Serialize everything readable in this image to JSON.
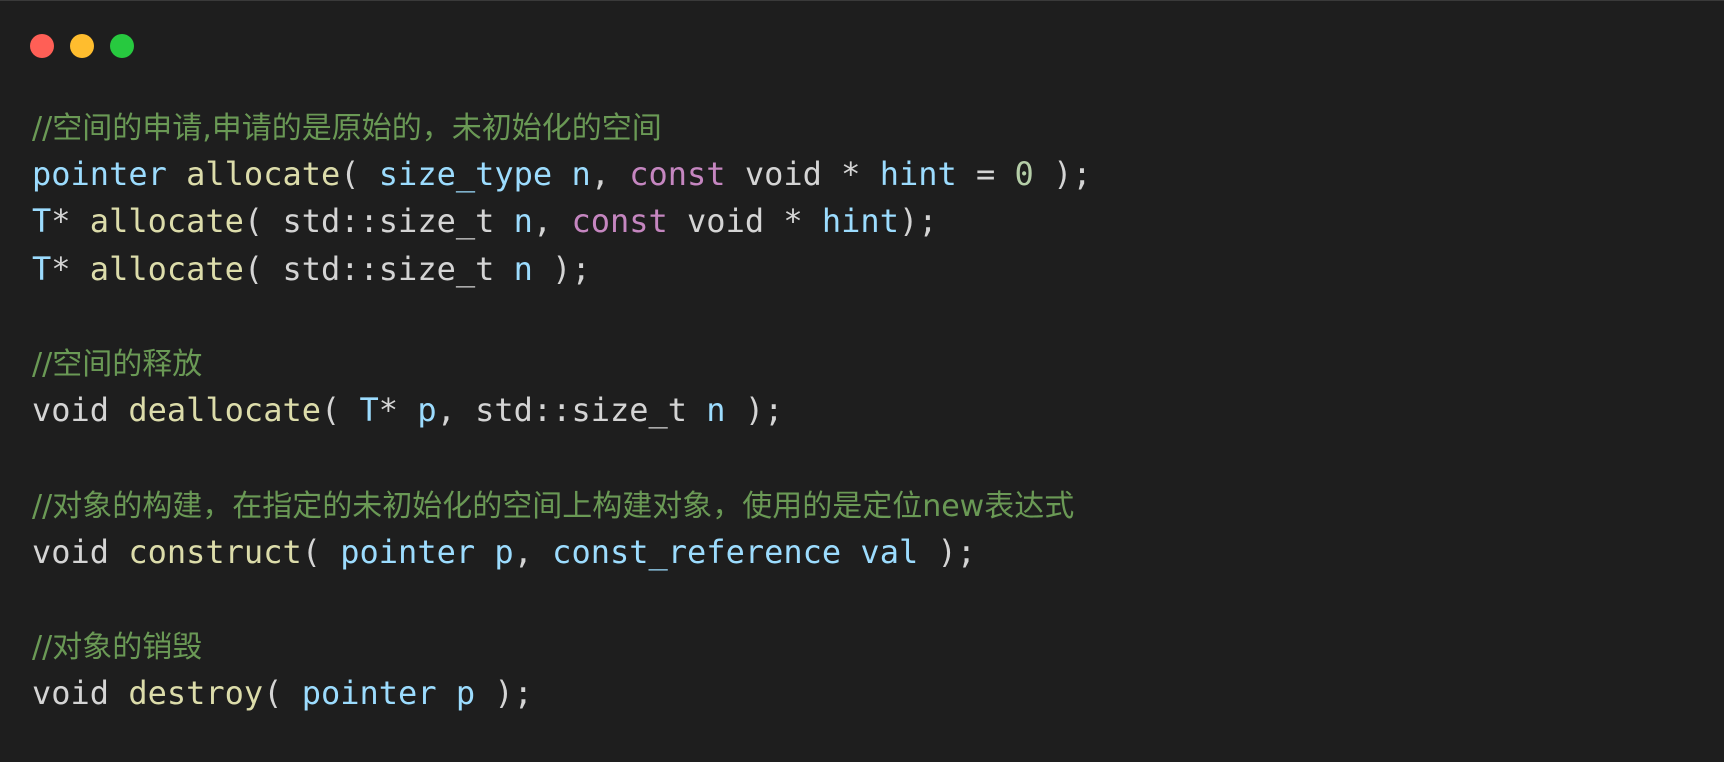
{
  "window": {
    "buttons": [
      {
        "name": "close-button",
        "color": "#ff5f56"
      },
      {
        "name": "minimize-button",
        "color": "#ffbd2e"
      },
      {
        "name": "maximize-button",
        "color": "#27c93f"
      }
    ],
    "background": "#1e1e1e"
  },
  "colors": {
    "comment": "#6a9955",
    "type": "#9cdcfe",
    "function": "#dcdcaa",
    "keyword": "#c586c0",
    "number": "#b5cea8",
    "plain": "#d4d4d4"
  },
  "code": {
    "lines": [
      [
        {
          "t": "//空间的申请,申请的是原始的，未初始化的空间",
          "c": "comment"
        }
      ],
      [
        {
          "t": "pointer",
          "c": "type"
        },
        {
          "t": " ",
          "c": "plain"
        },
        {
          "t": "allocate",
          "c": "function"
        },
        {
          "t": "( ",
          "c": "plain"
        },
        {
          "t": "size_type",
          "c": "type"
        },
        {
          "t": " ",
          "c": "plain"
        },
        {
          "t": "n",
          "c": "type"
        },
        {
          "t": ", ",
          "c": "plain"
        },
        {
          "t": "const",
          "c": "keyword"
        },
        {
          "t": " void * ",
          "c": "plain"
        },
        {
          "t": "hint",
          "c": "type"
        },
        {
          "t": " = ",
          "c": "plain"
        },
        {
          "t": "0",
          "c": "number"
        },
        {
          "t": " );",
          "c": "plain"
        }
      ],
      [
        {
          "t": "T",
          "c": "type"
        },
        {
          "t": "* ",
          "c": "plain"
        },
        {
          "t": "allocate",
          "c": "function"
        },
        {
          "t": "( std::size_t ",
          "c": "plain"
        },
        {
          "t": "n",
          "c": "type"
        },
        {
          "t": ", ",
          "c": "plain"
        },
        {
          "t": "const",
          "c": "keyword"
        },
        {
          "t": " void * ",
          "c": "plain"
        },
        {
          "t": "hint",
          "c": "type"
        },
        {
          "t": ");",
          "c": "plain"
        }
      ],
      [
        {
          "t": "T",
          "c": "type"
        },
        {
          "t": "* ",
          "c": "plain"
        },
        {
          "t": "allocate",
          "c": "function"
        },
        {
          "t": "( std::size_t ",
          "c": "plain"
        },
        {
          "t": "n",
          "c": "type"
        },
        {
          "t": " );",
          "c": "plain"
        }
      ],
      [],
      [
        {
          "t": "//空间的释放",
          "c": "comment"
        }
      ],
      [
        {
          "t": "void ",
          "c": "plain"
        },
        {
          "t": "deallocate",
          "c": "function"
        },
        {
          "t": "( ",
          "c": "plain"
        },
        {
          "t": "T",
          "c": "type"
        },
        {
          "t": "* ",
          "c": "plain"
        },
        {
          "t": "p",
          "c": "type"
        },
        {
          "t": ", std::size_t ",
          "c": "plain"
        },
        {
          "t": "n",
          "c": "type"
        },
        {
          "t": " );",
          "c": "plain"
        }
      ],
      [],
      [
        {
          "t": "//对象的构建，在指定的未初始化的空间上构建对象，使用的是定位new表达式",
          "c": "comment"
        }
      ],
      [
        {
          "t": "void ",
          "c": "plain"
        },
        {
          "t": "construct",
          "c": "function"
        },
        {
          "t": "( ",
          "c": "plain"
        },
        {
          "t": "pointer",
          "c": "type"
        },
        {
          "t": " ",
          "c": "plain"
        },
        {
          "t": "p",
          "c": "type"
        },
        {
          "t": ", ",
          "c": "plain"
        },
        {
          "t": "const_reference",
          "c": "type"
        },
        {
          "t": " ",
          "c": "plain"
        },
        {
          "t": "val",
          "c": "type"
        },
        {
          "t": " );",
          "c": "plain"
        }
      ],
      [],
      [
        {
          "t": "//对象的销毁",
          "c": "comment"
        }
      ],
      [
        {
          "t": "void ",
          "c": "plain"
        },
        {
          "t": "destroy",
          "c": "function"
        },
        {
          "t": "( ",
          "c": "plain"
        },
        {
          "t": "pointer",
          "c": "type"
        },
        {
          "t": " ",
          "c": "plain"
        },
        {
          "t": "p",
          "c": "type"
        },
        {
          "t": " );",
          "c": "plain"
        }
      ]
    ]
  }
}
